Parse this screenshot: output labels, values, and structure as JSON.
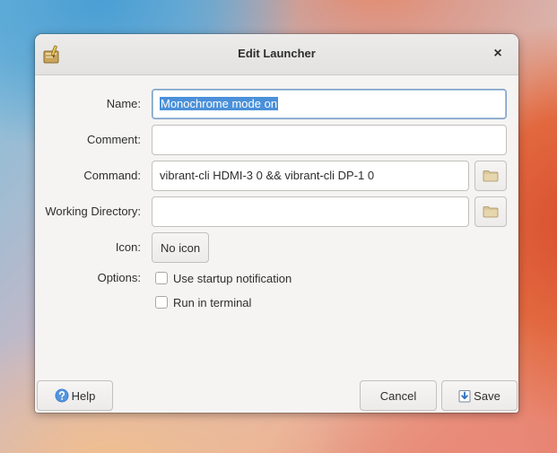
{
  "window": {
    "title": "Edit Launcher",
    "icon": "launcher-edit-icon",
    "close_glyph": "×"
  },
  "form": {
    "name": {
      "label": "Name:",
      "value": "Monochrome mode on"
    },
    "comment": {
      "label": "Comment:",
      "value": ""
    },
    "command": {
      "label": "Command:",
      "value": "vibrant-cli HDMI-3 0 && vibrant-cli DP-1 0"
    },
    "working_directory": {
      "label": "Working Directory:",
      "value": ""
    },
    "icon": {
      "label": "Icon:",
      "button_label": "No icon"
    },
    "options": {
      "label": "Options:",
      "startup_notification": {
        "label": "Use startup notification",
        "checked": false
      },
      "run_in_terminal": {
        "label": "Run in terminal",
        "checked": false
      }
    }
  },
  "footer": {
    "help_label": "Help",
    "cancel_label": "Cancel",
    "save_label": "Save"
  },
  "colors": {
    "selection": "#4a90d9",
    "help_icon": "#3d7fcf",
    "folder_icon": "#d9c69a"
  }
}
